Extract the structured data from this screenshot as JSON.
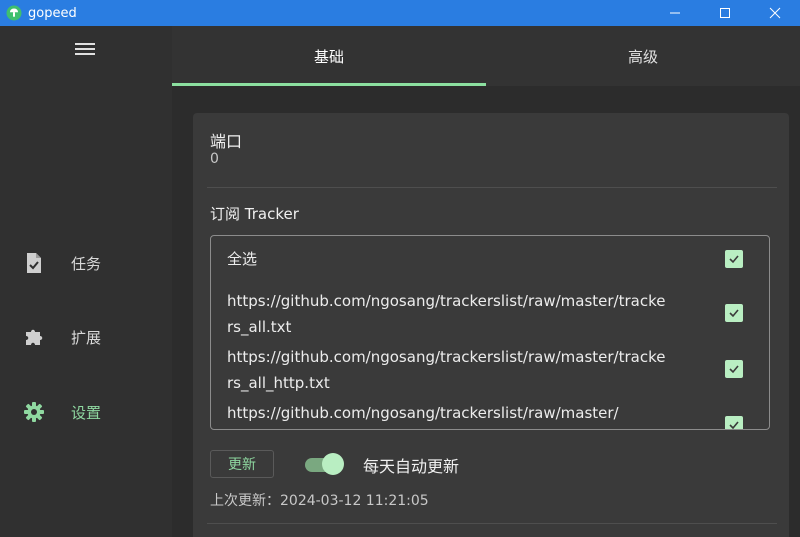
{
  "window": {
    "title": "gopeed",
    "controls": {
      "minimize": "minimize-icon",
      "maximize": "maximize-icon",
      "close": "close-icon"
    },
    "accent": "#2a7de1"
  },
  "sidebar": {
    "menu_icon": "hamburger-menu-icon",
    "items": [
      {
        "label": "任务",
        "icon": "task-document-icon",
        "active": false
      },
      {
        "label": "扩展",
        "icon": "puzzle-extension-icon",
        "active": false
      },
      {
        "label": "设置",
        "icon": "gear-icon",
        "active": true
      }
    ],
    "active_color": "#8fd8a0"
  },
  "tabs": [
    {
      "label": "基础",
      "active": true
    },
    {
      "label": "高级",
      "active": false
    }
  ],
  "settings": {
    "port": {
      "label": "端口",
      "value": "0"
    },
    "tracker": {
      "title": "订阅 Tracker",
      "items": [
        {
          "text": "全选",
          "checked": true
        },
        {
          "text": "https://github.com/ngosang/trackerslist/raw/master/trackers_all.txt",
          "checked": true
        },
        {
          "text": "https://github.com/ngosang/trackerslist/raw/master/trackers_all_http.txt",
          "checked": true
        },
        {
          "text": "https://github.com/ngosang/trackerslist/raw/master/",
          "checked": true
        }
      ]
    },
    "update_button": "更新",
    "auto_update": {
      "label": "每天自动更新",
      "enabled": true
    },
    "last_update": "上次更新：2024-03-12 11:21:05"
  }
}
